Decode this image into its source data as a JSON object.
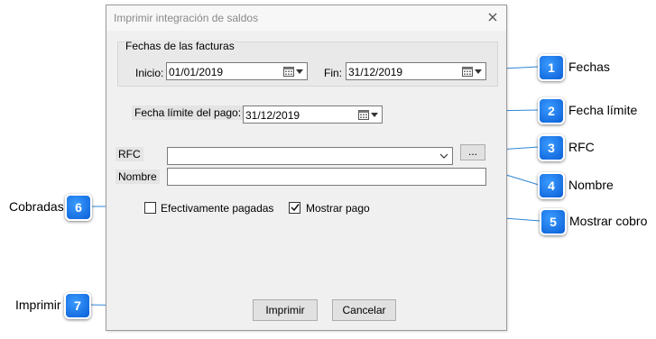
{
  "dialog": {
    "title": "Imprimir integración de saldos",
    "group_title": "Fechas de las facturas",
    "inicio_label": "Inicio:",
    "inicio_value": "01/01/2019",
    "fin_label": "Fin:",
    "fin_value": "31/12/2019",
    "fecha_limite_label": "Fecha límite del pago:",
    "fecha_limite_value": "31/12/2019",
    "rfc_label": "RFC",
    "rfc_value": "",
    "browse_label": "...",
    "nombre_label": "Nombre",
    "nombre_value": "",
    "efectivamente_label": "Efectivamente pagadas",
    "efectivamente_checked": false,
    "mostrar_pago_label": "Mostrar pago",
    "mostrar_pago_checked": true,
    "imprimir_label": "Imprimir",
    "cancelar_label": "Cancelar"
  },
  "callouts": [
    {
      "number": "1",
      "text": "Fechas"
    },
    {
      "number": "2",
      "text": "Fecha límite"
    },
    {
      "number": "3",
      "text": "RFC"
    },
    {
      "number": "4",
      "text": "Nombre"
    },
    {
      "number": "5",
      "text": "Mostrar cobro"
    },
    {
      "number": "6",
      "text": "Cobradas"
    },
    {
      "number": "7",
      "text": "Imprimir"
    }
  ],
  "colors": {
    "badge": "#1573e6",
    "callout_line": "#2f86d6"
  }
}
